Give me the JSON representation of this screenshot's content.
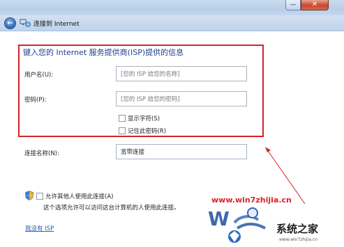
{
  "window": {
    "title": "连接到 Internet",
    "min_label": "—",
    "close_label": "✕"
  },
  "form": {
    "heading": "键入您的 Internet 服务提供商(ISP)提供的信息",
    "username_label": "用户名(U):",
    "username_placeholder": "[您的 ISP 给您的名称]",
    "password_label": "密码(P):",
    "password_placeholder": "[您的 ISP 给您的密码]",
    "show_chars_label": "显示字符(S)",
    "remember_label": "记住此密码(R)",
    "show_chars_checked": false,
    "remember_checked": false,
    "conn_name_label": "连接名称(N):",
    "conn_name_value": "宽带连接"
  },
  "sharing": {
    "allow_label": "允许其他人使用此连接(A)",
    "allow_checked": false,
    "description": "这个选项允许可以访问这台计算机的人使用此连接。"
  },
  "link": {
    "no_isp": "我没有 ISP"
  },
  "watermark": {
    "url": "www.win7zhijia.cn",
    "brand": "系统之家",
    "small": "www.win7zhijia.cn"
  },
  "colors": {
    "accent_red": "#d2232a",
    "heading_blue": "#1e3f8a",
    "link_blue": "#2a5fb7"
  },
  "icons": {
    "back": "back-arrow-icon",
    "network": "network-connection-icon",
    "shield": "uac-shield-icon"
  }
}
